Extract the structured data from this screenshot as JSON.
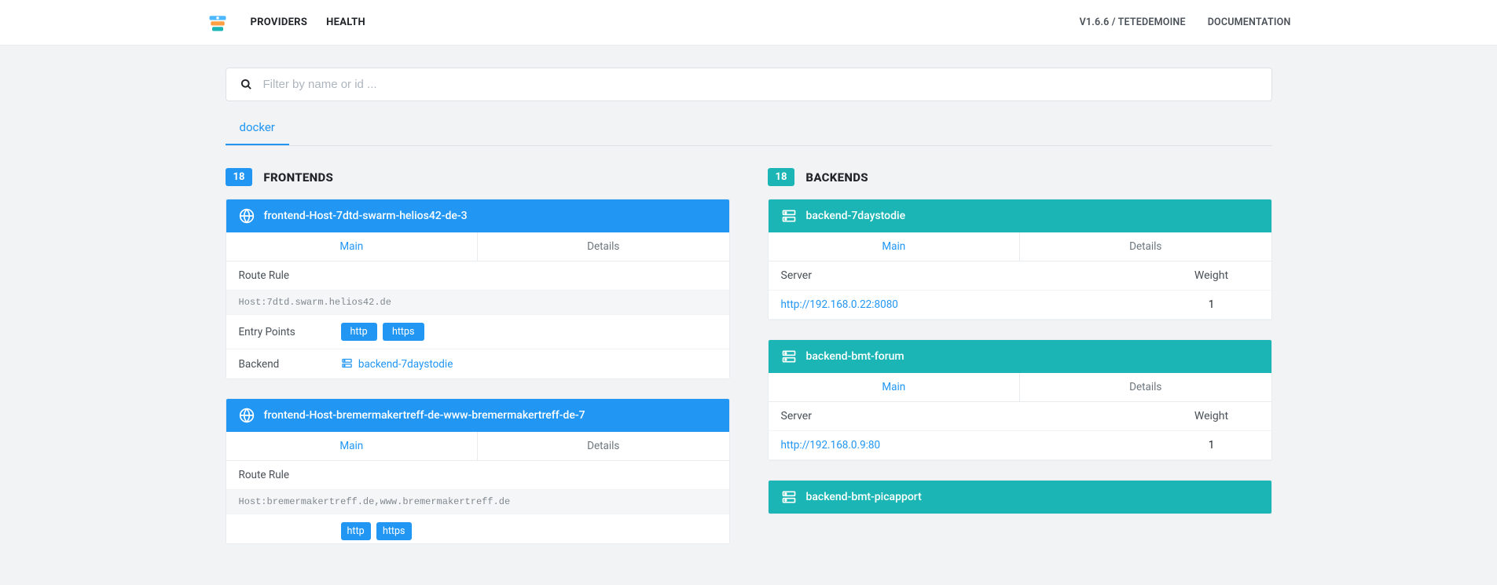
{
  "nav": {
    "providers": "PROVIDERS",
    "health": "HEALTH",
    "version": "V1.6.6 / TETEDEMOINE",
    "documentation": "DOCUMENTATION"
  },
  "search": {
    "placeholder": "Filter by name or id ..."
  },
  "providers_tabs": {
    "docker": "docker"
  },
  "frontends": {
    "count": "18",
    "title": "FRONTENDS",
    "tab_main": "Main",
    "tab_details": "Details",
    "label_route_rule": "Route Rule",
    "label_entry_points": "Entry Points",
    "label_backend": "Backend",
    "items": [
      {
        "name": "frontend-Host-7dtd-swarm-helios42-de-3",
        "rule": "Host:7dtd.swarm.helios42.de",
        "entry_http": "http",
        "entry_https": "https",
        "backend": "backend-7daystodie"
      },
      {
        "name": "frontend-Host-bremermakertreff-de-www-bremermakertreff-de-7",
        "rule": "Host:bremermakertreff.de,www.bremermakertreff.de",
        "entry_http": "http",
        "entry_https": "https",
        "backend": ""
      }
    ]
  },
  "backends": {
    "count": "18",
    "title": "BACKENDS",
    "tab_main": "Main",
    "tab_details": "Details",
    "label_server": "Server",
    "label_weight": "Weight",
    "items": [
      {
        "name": "backend-7daystodie",
        "server": "http://192.168.0.22:8080",
        "weight": "1"
      },
      {
        "name": "backend-bmt-forum",
        "server": "http://192.168.0.9:80",
        "weight": "1"
      },
      {
        "name": "backend-bmt-picapport",
        "server": "",
        "weight": ""
      }
    ]
  }
}
